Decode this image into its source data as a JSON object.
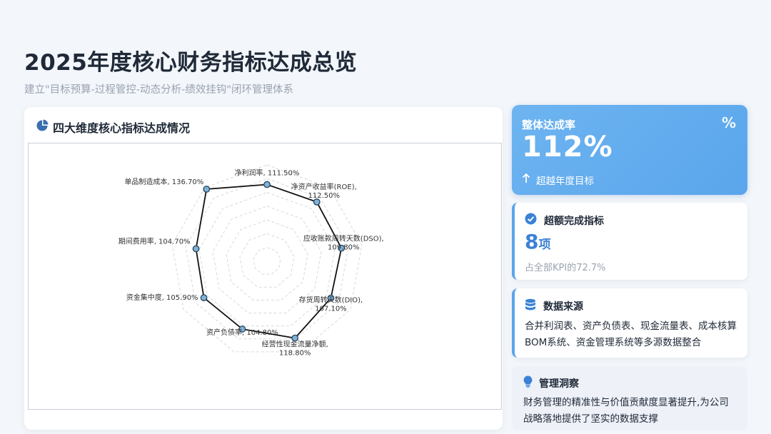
{
  "header": {
    "title": "2025年度核心财务指标达成总览",
    "subtitle": "建立\"目标预算-过程管控-动态分析-绩效挂钩\"闭环管理体系"
  },
  "chart_card": {
    "title": "四大维度核心指标达成情况",
    "icon": "pie-chart-icon"
  },
  "chart_data": {
    "type": "radar",
    "categories": [
      "净利润率",
      "净资产收益率(ROE)",
      "应收账款周转天数(DSO)",
      "存货周转天数(DIO)",
      "经营性现金流量净额",
      "资产负债率",
      "资金集中度",
      "期间费用率",
      "单品制造成本"
    ],
    "values": [
      111.5,
      112.5,
      109.8,
      107.1,
      118.8,
      104.8,
      105.9,
      104.7,
      136.7
    ],
    "value_labels": [
      "111.50%",
      "112.50%",
      "109.80%",
      "107.10%",
      "118.80%",
      "104.80%",
      "105.90%",
      "104.70%",
      "136.70%"
    ],
    "grid": true,
    "colors": {
      "line": "#111111",
      "point_fill": "#7fb3d9",
      "point_stroke": "#2c4a63",
      "grid": "#d5d9df"
    }
  },
  "summary": {
    "rate_label": "整体达成率",
    "rate_value": "112%",
    "rate_note": "超越年度目标",
    "percent_icon": "%"
  },
  "kpi": {
    "label": "超额完成指标",
    "count": "8",
    "unit": "项",
    "note": "占全部KPI的72.7%"
  },
  "source": {
    "label": "数据来源",
    "text": "合并利润表、资产负债表、现金流量表、成本核算BOM系统、资金管理系统等多源数据整合"
  },
  "insight": {
    "label": "管理洞察",
    "text": "财务管理的精准性与价值贡献度显著提升,为公司战略落地提供了坚实的数据支撑"
  },
  "colors": {
    "accent": "#5aa5ec",
    "accent_dark": "#3b82d6"
  }
}
